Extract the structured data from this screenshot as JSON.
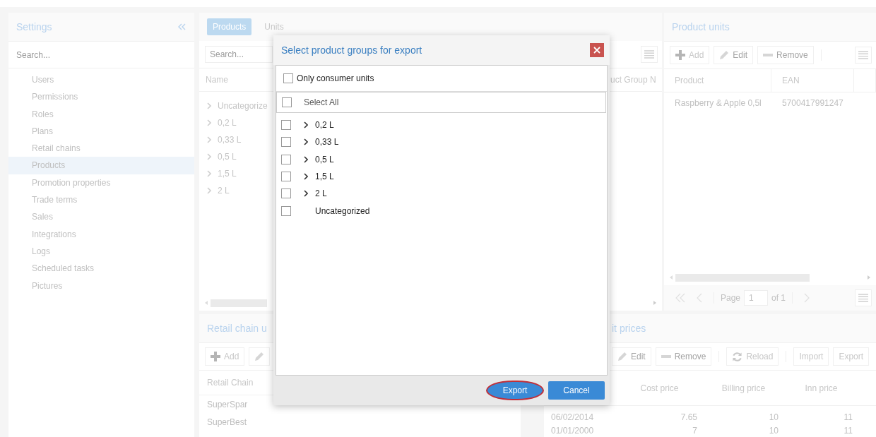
{
  "sidebar": {
    "title": "Settings",
    "search": {
      "placeholder": "Search..."
    },
    "items": [
      {
        "label": "Users",
        "selected": false
      },
      {
        "label": "Permissions",
        "selected": false
      },
      {
        "label": "Roles",
        "selected": false
      },
      {
        "label": "Plans",
        "selected": false
      },
      {
        "label": "Retail chains",
        "selected": false
      },
      {
        "label": "Products",
        "selected": true
      },
      {
        "label": "Promotion properties",
        "selected": false
      },
      {
        "label": "Trade terms",
        "selected": false
      },
      {
        "label": "Sales",
        "selected": false
      },
      {
        "label": "Integrations",
        "selected": false
      },
      {
        "label": "Logs",
        "selected": false
      },
      {
        "label": "Scheduled tasks",
        "selected": false
      },
      {
        "label": "Pictures",
        "selected": false
      }
    ]
  },
  "tabs": [
    {
      "label": "Products",
      "selected": true
    },
    {
      "label": "Units",
      "selected": false
    }
  ],
  "groups_panel": {
    "search": {
      "placeholder": "Search..."
    },
    "columns": [
      "Name",
      "uct Group N"
    ],
    "rows": [
      "Uncategorize",
      "0,2 L",
      "0,33 L",
      "0,5 L",
      "1,5 L",
      "2 L"
    ]
  },
  "units_panel": {
    "title": "Product units",
    "toolbar": [
      {
        "kind": "add",
        "label": "Add",
        "disabled": false
      },
      {
        "kind": "edit",
        "label": "Edit",
        "disabled": true
      },
      {
        "kind": "remove",
        "label": "Remove",
        "disabled": true
      }
    ],
    "columns": [
      "Product",
      "EAN"
    ],
    "rows": [
      [
        "Raspberry & Apple 0,5l",
        "5700417991247"
      ]
    ],
    "pager": {
      "label": "Page",
      "page": "1",
      "total": "of 1"
    }
  },
  "chains_panel": {
    "title": "Retail chain u",
    "toolbar": [
      {
        "kind": "add",
        "label": "Add",
        "disabled": false
      },
      {
        "kind": "edit",
        "disabled": true
      }
    ],
    "columns": [
      "Retail Chain"
    ],
    "rows": [
      "SuperSpar",
      "SuperBest"
    ]
  },
  "prices_panel": {
    "title": "it prices",
    "toolbar": [
      {
        "kind": "edit",
        "label": "Edit",
        "disabled": true
      },
      {
        "kind": "remove",
        "label": "Remove",
        "disabled": true
      },
      {
        "kind": "reload",
        "label": "Reload",
        "disabled": false
      },
      {
        "kind": "plain",
        "label": "Import",
        "disabled": false
      },
      {
        "kind": "plain",
        "label": "Export",
        "disabled": false
      }
    ],
    "columns": [
      "Cost price",
      "Billing price",
      "Inn price"
    ],
    "rows": [
      [
        "06/02/2014",
        "7.65",
        "10",
        "11"
      ],
      [
        "01/01/2000",
        "7",
        "10",
        "11"
      ]
    ]
  },
  "dialog": {
    "title": "Select product groups for export",
    "only_consumer_units": {
      "label": "Only consumer units",
      "checked": false
    },
    "select_all": {
      "label": "Select All",
      "checked": false
    },
    "groups": [
      {
        "label": "0,2 L",
        "checked": false,
        "expandable": true
      },
      {
        "label": "0,33 L",
        "checked": false,
        "expandable": true
      },
      {
        "label": "0,5 L",
        "checked": false,
        "expandable": true
      },
      {
        "label": "1,5 L",
        "checked": false,
        "expandable": true
      },
      {
        "label": "2 L",
        "checked": false,
        "expandable": true
      },
      {
        "label": "Uncategorized",
        "checked": false,
        "expandable": false
      }
    ],
    "buttons": [
      {
        "label": "Export",
        "highlighted": true
      },
      {
        "label": "Cancel",
        "highlighted": false
      }
    ]
  }
}
